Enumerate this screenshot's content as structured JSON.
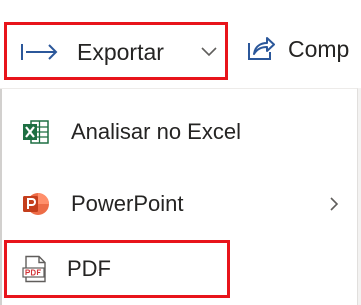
{
  "toolbar": {
    "export_label": "Exportar",
    "export_icon": "export-arrow-icon",
    "export_chevron_icon": "chevron-down-icon",
    "share_label": "Comp",
    "share_icon": "share-icon"
  },
  "menu": {
    "items": [
      {
        "label": "Analisar no Excel",
        "icon": "excel-icon",
        "has_submenu": false
      },
      {
        "label": "PowerPoint",
        "icon": "powerpoint-icon",
        "has_submenu": true
      },
      {
        "label": "PDF",
        "icon": "pdf-icon",
        "has_submenu": false
      }
    ]
  },
  "colors": {
    "highlight_border": "#e8141b",
    "excel_green": "#1d6f42",
    "powerpoint_orange": "#c43e1c",
    "accent_blue": "#2b579a",
    "text": "#252423"
  }
}
